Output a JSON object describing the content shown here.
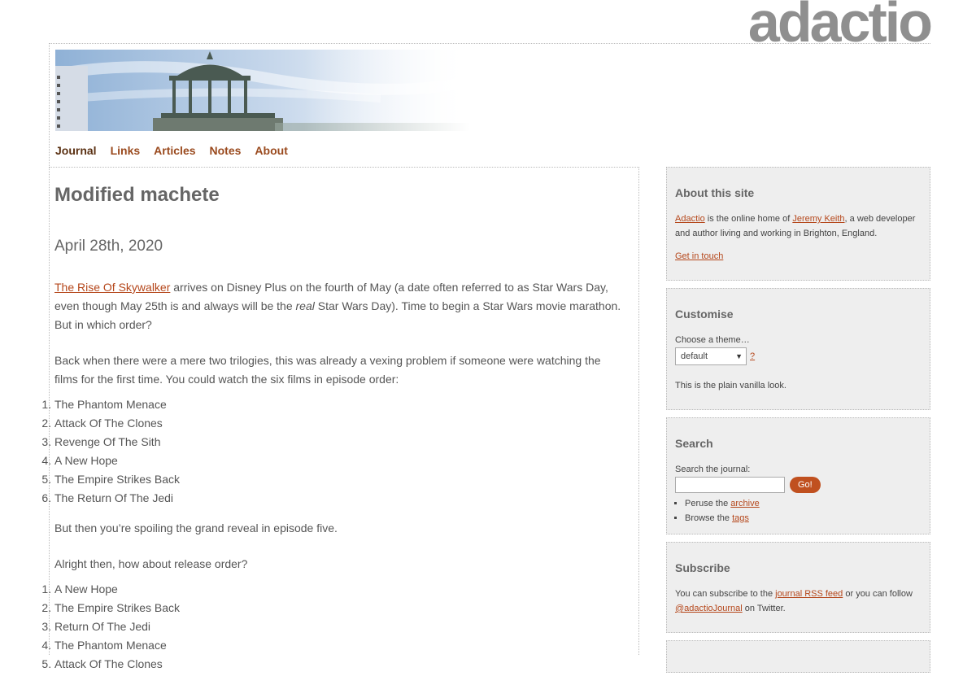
{
  "logo": "adactio",
  "nav": [
    "Journal",
    "Links",
    "Articles",
    "Notes",
    "About"
  ],
  "article": {
    "title": "Modified machete",
    "date": "April 28th, 2020",
    "p1_link": "The Rise Of Skywalker",
    "p1_text_a": " arrives on Disney Plus on the fourth of May (a date often referred to as Star Wars Day, even though May 25th is and always will be the ",
    "p1_em": "real",
    "p1_text_b": " Star Wars Day). Time to begin a Star Wars movie marathon. But in which order?",
    "p2": "Back when there were a mere two trilogies, this was already a vexing problem if someone were watching the films for the first time. You could watch the six films in episode order:",
    "list1": [
      "The Phantom Menace",
      "Attack Of The Clones",
      "Revenge Of The Sith",
      "A New Hope",
      "The Empire Strikes Back",
      "The Return Of The Jedi"
    ],
    "p3": "But then you’re spoiling the grand reveal in episode five.",
    "p4": "Alright then, how about release order?",
    "list2": [
      "A New Hope",
      "The Empire Strikes Back",
      "Return Of The Jedi",
      "The Phantom Menace",
      "Attack Of The Clones"
    ]
  },
  "sidebar": {
    "about": {
      "title": "About this site",
      "link1": "Adactio",
      "text1": " is the online home of ",
      "link2": "Jeremy Keith",
      "text2": ", a web developer and author living and working in Brighton, England.",
      "contact": "Get in touch"
    },
    "customise": {
      "title": "Customise",
      "label": "Choose a theme…",
      "selected": "default",
      "help": "?",
      "desc": "This is the plain vanilla look."
    },
    "search": {
      "title": "Search",
      "label": "Search the journal:",
      "button": "Go!",
      "peruse": "Peruse the ",
      "archive": "archive",
      "browse": "Browse the ",
      "tags": "tags"
    },
    "subscribe": {
      "title": "Subscribe",
      "text1": "You can subscribe to the ",
      "feed": "journal RSS feed",
      "text2": " or you can follow ",
      "twitter": "@adactioJournal",
      "text3": " on Twitter."
    }
  }
}
